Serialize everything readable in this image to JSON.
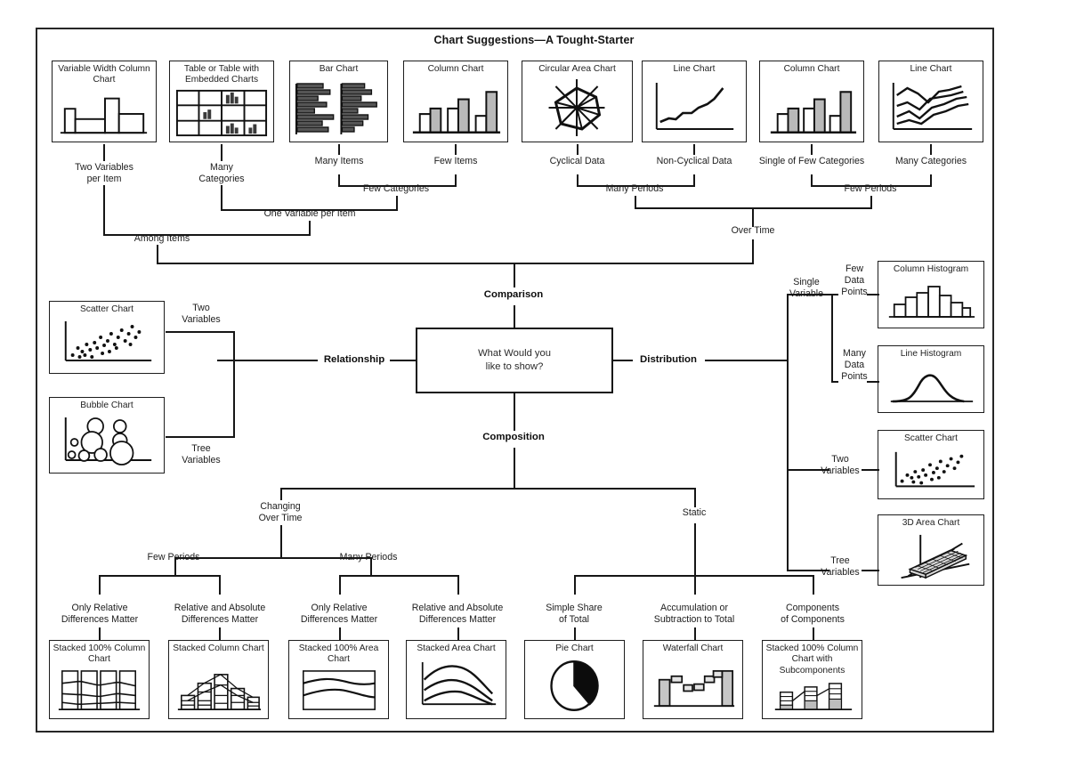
{
  "title": "Chart Suggestions—A Tought-Starter",
  "center": {
    "question": "What Would you\nlike to show?"
  },
  "branches": {
    "comparison": "Comparison",
    "relationship": "Relationship",
    "distribution": "Distribution",
    "composition": "Composition"
  },
  "top_cards": [
    {
      "name": "variable-width-column-chart",
      "label": "Variable Width\nColumn Chart"
    },
    {
      "name": "table-or-table-with-embedded-charts",
      "label": "Table or Table with\nEmbedded Charts"
    },
    {
      "name": "bar-chart",
      "label": "Bar Chart"
    },
    {
      "name": "column-chart-few-items",
      "label": "Column Chart"
    },
    {
      "name": "circular-area-chart",
      "label": "Circular Area Chart"
    },
    {
      "name": "line-chart-non-cyclical",
      "label": "Line Chart"
    },
    {
      "name": "column-chart-few-periods",
      "label": "Column Chart"
    },
    {
      "name": "line-chart-many-categories",
      "label": "Line Chart"
    }
  ],
  "top_leaf_labels": [
    "Two Variables\nper Item",
    "Many\nCategories",
    "Many Items",
    "Few Items",
    "Cyclical Data",
    "Non-Cyclical Data",
    "Single of Few Categories",
    "Many Categories"
  ],
  "comparison_mid_labels": {
    "one_variable_per_item": "One Variable per Item",
    "few_categories": "Few Categories",
    "among_items": "Among Items",
    "many_periods": "Many Periods",
    "few_periods": "Few Periods",
    "over_time": "Over Time"
  },
  "relationship_cards": [
    {
      "name": "scatter-chart-relationship",
      "label": "Scatter Chart",
      "edge": "Two\nVariables"
    },
    {
      "name": "bubble-chart",
      "label": "Bubble Chart",
      "edge": "Tree\nVariables"
    }
  ],
  "distribution": {
    "single_variable": "Single\nVariable",
    "branches": [
      {
        "name": "column-histogram",
        "label": "Column Histogram",
        "edge": "Few\nData\nPoints"
      },
      {
        "name": "line-histogram",
        "label": "Line Histogram",
        "edge": "Many\nData\nPoints"
      },
      {
        "name": "scatter-chart-distribution",
        "label": "Scatter Chart",
        "edge": "Two\nVariables"
      },
      {
        "name": "3d-area-chart",
        "label": "3D Area Chart",
        "edge": "Tree\nVariables"
      }
    ]
  },
  "composition": {
    "changing_over_time": "Changing\nOver Time",
    "static": "Static",
    "few_periods": "Few Periods",
    "many_periods": "Many Periods",
    "leaf_labels": [
      "Only Relative\nDifferences Matter",
      "Relative and Absolute\nDifferences Matter",
      "Only Relative\nDifferences Matter",
      "Relative and Absolute\nDifferences Matter",
      "Simple Share\nof Total",
      "Accumulation or\nSubtraction to Total",
      "Components\nof Components"
    ],
    "cards": [
      {
        "name": "stacked-100-column-chart",
        "label": "Stacked 100%\nColumn Chart"
      },
      {
        "name": "stacked-column-chart",
        "label": "Stacked\nColumn Chart"
      },
      {
        "name": "stacked-100-area-chart",
        "label": "Stacked 100%\nArea Chart"
      },
      {
        "name": "stacked-area-chart",
        "label": "Stacked Area Chart"
      },
      {
        "name": "pie-chart",
        "label": "Pie Chart"
      },
      {
        "name": "waterfall-chart",
        "label": "Waterfall Chart"
      },
      {
        "name": "stacked-100-column-chart-with-subcomponents",
        "label": "Stacked 100%\nColumn Chart with\nSubcomponents"
      }
    ]
  },
  "chart_data": {
    "type": "diagram",
    "title": "Chart Suggestions—A Tought-Starter",
    "root": "What Would you like to show?",
    "nodes": [
      {
        "branch": "Comparison",
        "path": "Among Items > One Variable per Item > Many Categories",
        "chart": "Table or Table with Embedded Charts"
      },
      {
        "branch": "Comparison",
        "path": "Among Items > Two Variables per Item",
        "chart": "Variable Width Column Chart"
      },
      {
        "branch": "Comparison",
        "path": "Among Items > One Variable per Item > Few Categories > Many Items",
        "chart": "Bar Chart"
      },
      {
        "branch": "Comparison",
        "path": "Among Items > One Variable per Item > Few Categories > Few Items",
        "chart": "Column Chart"
      },
      {
        "branch": "Comparison",
        "path": "Over Time > Many Periods > Cyclical Data",
        "chart": "Circular Area Chart"
      },
      {
        "branch": "Comparison",
        "path": "Over Time > Many Periods > Non-Cyclical Data",
        "chart": "Line Chart"
      },
      {
        "branch": "Comparison",
        "path": "Over Time > Few Periods > Single of Few Categories",
        "chart": "Column Chart"
      },
      {
        "branch": "Comparison",
        "path": "Over Time > Few Periods > Many Categories",
        "chart": "Line Chart"
      },
      {
        "branch": "Relationship",
        "path": "Two Variables",
        "chart": "Scatter Chart"
      },
      {
        "branch": "Relationship",
        "path": "Tree Variables",
        "chart": "Bubble Chart"
      },
      {
        "branch": "Distribution",
        "path": "Single Variable > Few Data Points",
        "chart": "Column Histogram"
      },
      {
        "branch": "Distribution",
        "path": "Single Variable > Many Data Points",
        "chart": "Line Histogram"
      },
      {
        "branch": "Distribution",
        "path": "Two Variables",
        "chart": "Scatter Chart"
      },
      {
        "branch": "Distribution",
        "path": "Tree Variables",
        "chart": "3D Area Chart"
      },
      {
        "branch": "Composition",
        "path": "Changing Over Time > Few Periods > Only Relative Differences Matter",
        "chart": "Stacked 100% Column Chart"
      },
      {
        "branch": "Composition",
        "path": "Changing Over Time > Few Periods > Relative and Absolute Differences Matter",
        "chart": "Stacked Column Chart"
      },
      {
        "branch": "Composition",
        "path": "Changing Over Time > Many Periods > Only Relative Differences Matter",
        "chart": "Stacked 100% Area Chart"
      },
      {
        "branch": "Composition",
        "path": "Changing Over Time > Many Periods > Relative and Absolute Differences Matter",
        "chart": "Stacked Area Chart"
      },
      {
        "branch": "Composition",
        "path": "Static > Simple Share of Total",
        "chart": "Pie Chart"
      },
      {
        "branch": "Composition",
        "path": "Static > Accumulation or Subtraction to Total",
        "chart": "Waterfall Chart"
      },
      {
        "branch": "Composition",
        "path": "Static > Components of Components",
        "chart": "Stacked 100% Column Chart with Subcomponents"
      }
    ]
  }
}
